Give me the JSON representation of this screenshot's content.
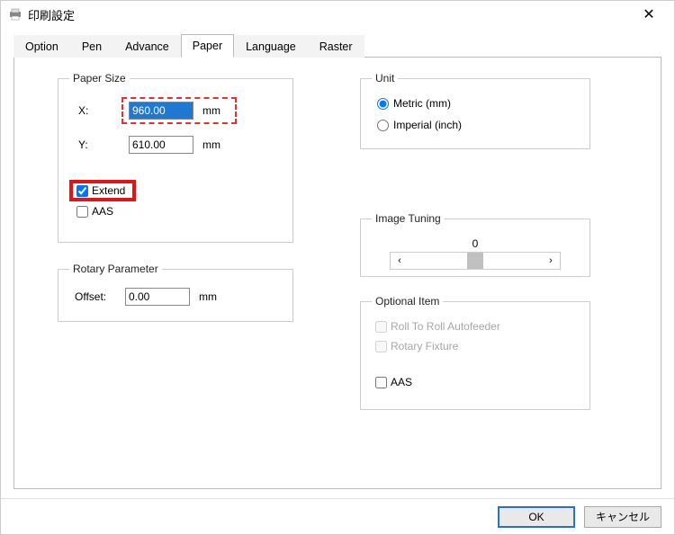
{
  "window": {
    "title": "印刷設定"
  },
  "tabs": {
    "items": [
      {
        "label": "Option"
      },
      {
        "label": "Pen"
      },
      {
        "label": "Advance"
      },
      {
        "label": "Paper"
      },
      {
        "label": "Language"
      },
      {
        "label": "Raster"
      }
    ],
    "active_index": 3
  },
  "paper_size": {
    "legend": "Paper Size",
    "x_label": "X:",
    "x_value": "960.00",
    "x_unit": "mm",
    "y_label": "Y:",
    "y_value": "610.00",
    "y_unit": "mm",
    "extend_label": "Extend",
    "extend_checked": true,
    "aas_label": "AAS",
    "aas_checked": false
  },
  "rotary": {
    "legend": "Rotary Parameter",
    "offset_label": "Offset:",
    "offset_value": "0.00",
    "offset_unit": "mm"
  },
  "unit": {
    "legend": "Unit",
    "metric_label": "Metric (mm)",
    "imperial_label": "Imperial (inch)",
    "selected": "metric"
  },
  "image_tuning": {
    "legend": "Image Tuning",
    "value": "0"
  },
  "optional": {
    "legend": "Optional Item",
    "roll_label": "Roll To Roll  Autofeeder",
    "roll_checked": false,
    "rotary_label": "Rotary Fixture",
    "rotary_checked": false,
    "aas_label": "AAS",
    "aas_checked": false
  },
  "footer": {
    "ok": "OK",
    "cancel": "キャンセル"
  }
}
